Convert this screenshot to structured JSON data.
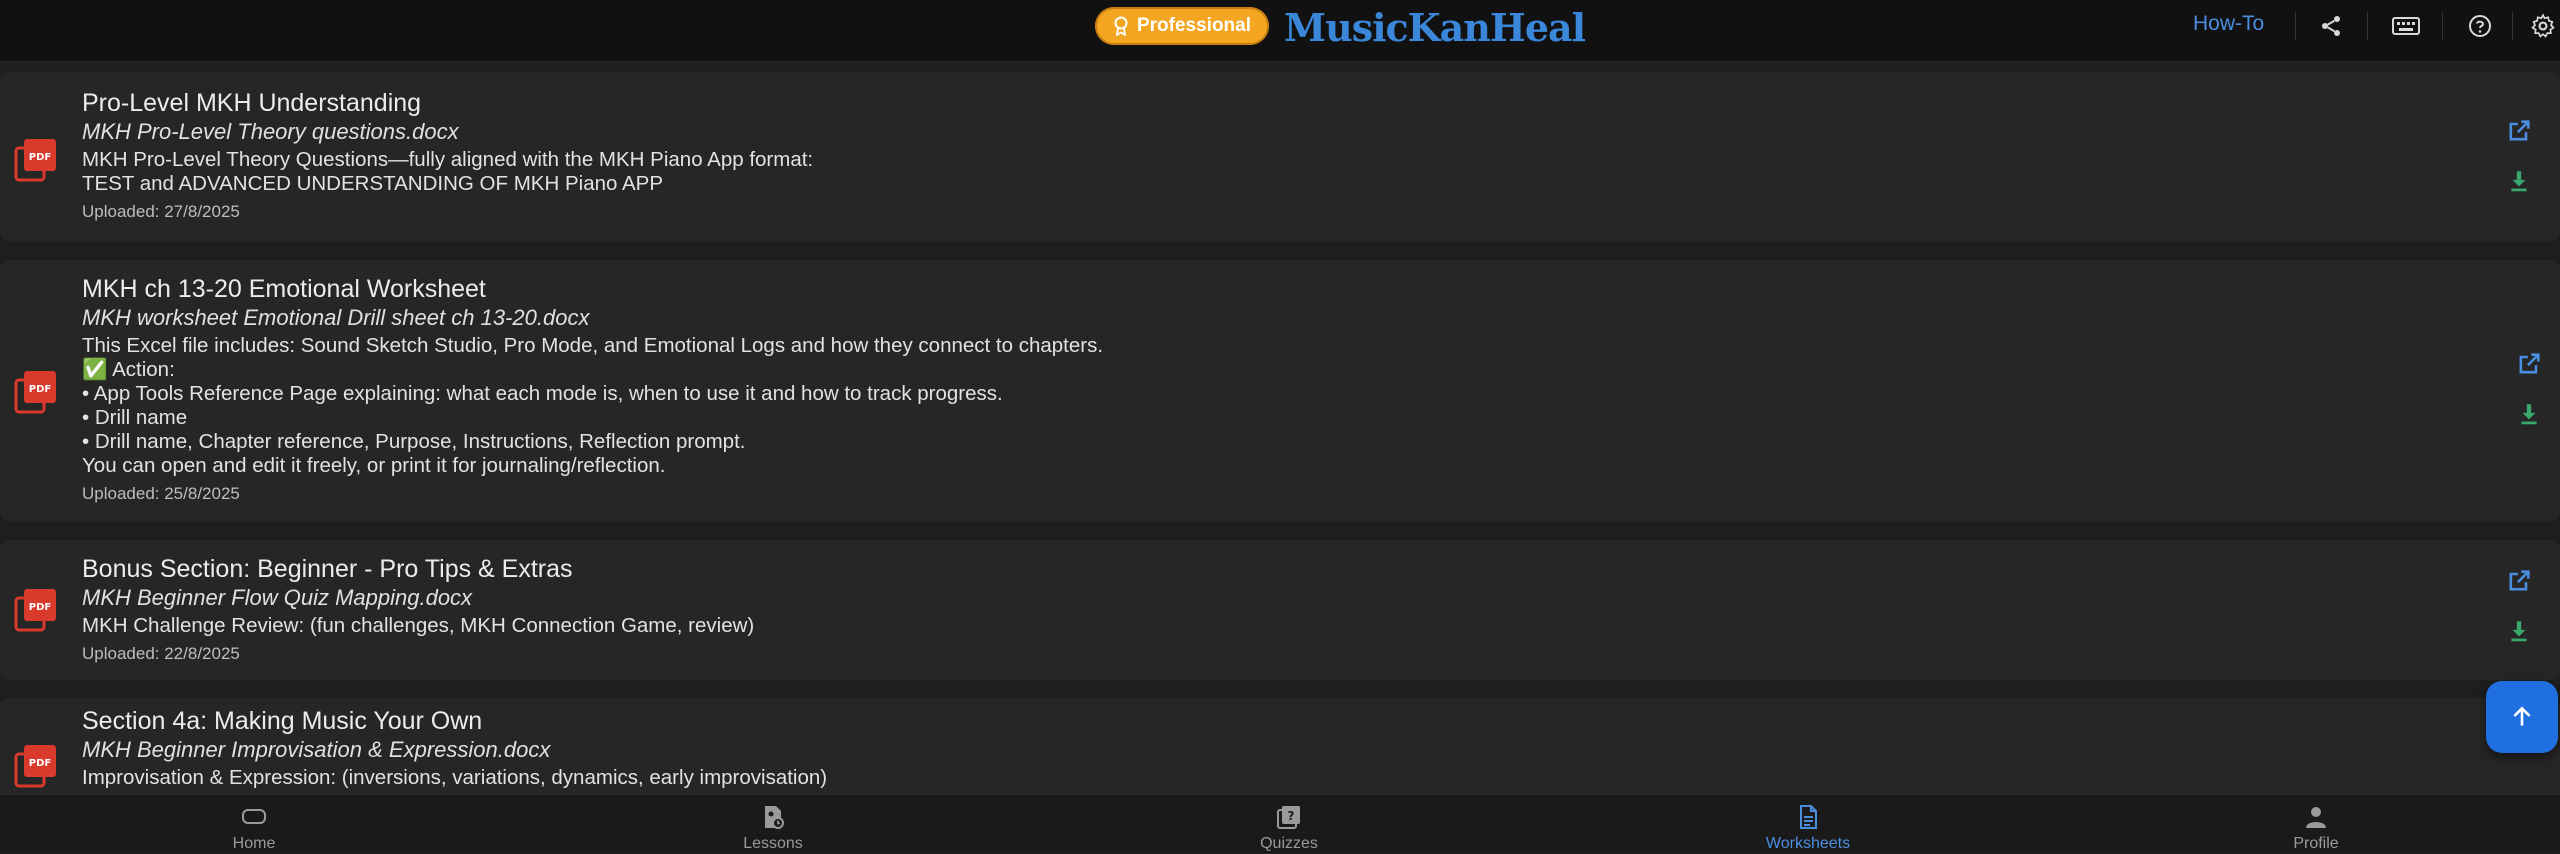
{
  "header": {
    "badge_label": "Professional",
    "brand": "MusicKanHeal",
    "howto": "How-To"
  },
  "colors": {
    "accent": "#4b8ee0",
    "badge": "#f4a623",
    "download": "#3aa76d",
    "pdf_red": "#d93a2b"
  },
  "items": [
    {
      "title": "Pro-Level MKH Understanding",
      "file": "MKH Pro-Level Theory questions.docx",
      "desc": "MKH Pro-Level Theory Questions—fully aligned with the MKH Piano App format:\nTEST and ADVANCED UNDERSTANDING OF MKH Piano APP",
      "date": "Uploaded: 27/8/2025",
      "icon": "pdf-icon"
    },
    {
      "title": "MKH ch 13-20 Emotional Worksheet",
      "file": "MKH worksheet Emotional Drill sheet ch 13-20.docx",
      "desc": "This Excel file includes: Sound Sketch Studio, Pro Mode, and Emotional Logs and how they connect to chapters.\n✅ Action:\n• App Tools Reference Page explaining: what each mode is, when to use it and how to track progress.\n• Drill name\n• Drill name, Chapter reference, Purpose, Instructions, Reflection prompt.\nYou can open and edit it freely, or print it for journaling/reflection.",
      "date": "Uploaded: 25/8/2025",
      "icon": "pdf-icon"
    },
    {
      "title": "Bonus Section: Beginner - Pro Tips & Extras",
      "file": "MKH Beginner Flow Quiz Mapping.docx",
      "desc": "MKH Challenge Review: (fun challenges, MKH Connection Game, review)",
      "date": "Uploaded: 22/8/2025",
      "icon": "pdf-icon"
    },
    {
      "title": "Section 4a: Making Music Your Own",
      "file": "MKH Beginner Improvisation & Expression.docx",
      "desc": "Improvisation & Expression: (inversions, variations, dynamics, early improvisation)",
      "date": "",
      "icon": "pdf-icon"
    }
  ],
  "nav": [
    {
      "label": "Home",
      "icon": "home-icon"
    },
    {
      "label": "Lessons",
      "icon": "lessons-icon"
    },
    {
      "label": "Quizzes",
      "icon": "quizzes-icon"
    },
    {
      "label": "Worksheets",
      "icon": "worksheets-icon",
      "active": true
    },
    {
      "label": "Profile",
      "icon": "profile-icon"
    }
  ]
}
